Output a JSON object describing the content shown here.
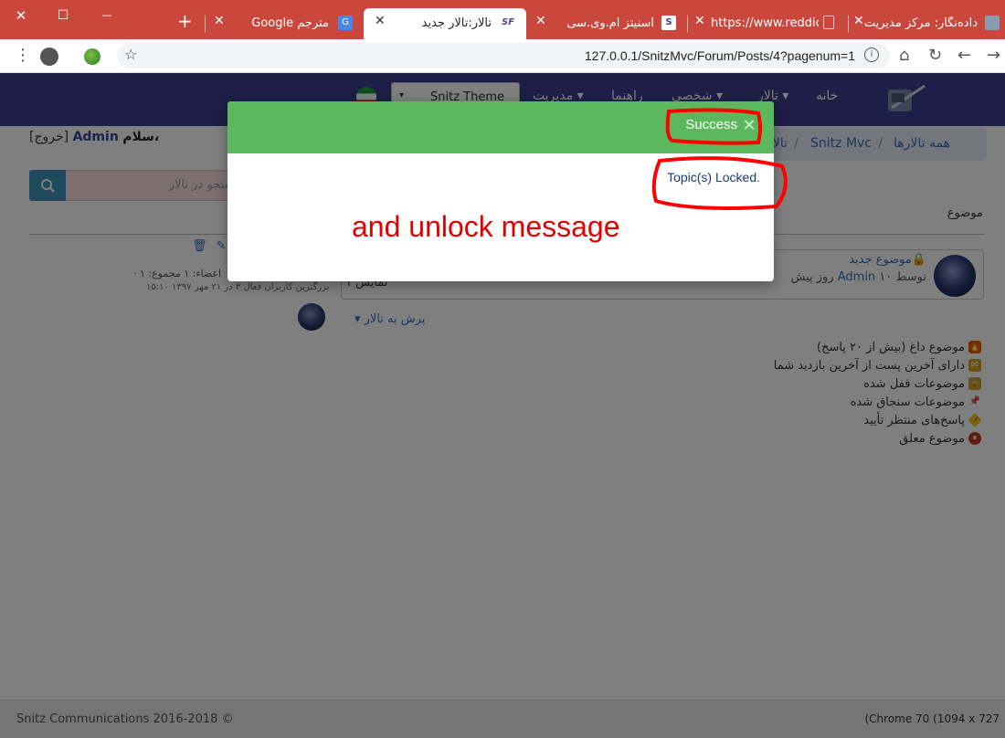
{
  "window": {
    "close_glyph": "✕",
    "maximize_glyph": "☐",
    "minimize_glyph": "—"
  },
  "tabs": [
    {
      "title": "داده‌نگار: مرکز مدیریت",
      "close": "✕",
      "favicon_color": "#8a9ab0"
    },
    {
      "title": "https://www.reddick.",
      "close": "✕",
      "favicon_color": "#ffffff"
    },
    {
      "title": "اسنیتز ام.وی.سی",
      "close": "✕",
      "favicon_color": "#3a3f8f",
      "favicon_text": "S"
    },
    {
      "title": "تالار:تالار جدید",
      "close": "✕",
      "favicon_color": "#ffffff",
      "favicon_text": "SF",
      "active": true
    },
    {
      "title": "مترجم Google",
      "close": "✕",
      "favicon_color": "#4a86e8",
      "favicon_text": "G"
    }
  ],
  "new_tab_glyph": "+",
  "address": {
    "url": "127.0.0.1/SnitzMvc/Forum/Posts/4?pagenum=1"
  },
  "nav": {
    "home": "خانه",
    "forums": "تالار ▾",
    "personal": "شخصی ▾",
    "help": "راهنما",
    "admin": "مدیریت ▾",
    "theme": "Snitz Theme",
    "theme_caret": "▾"
  },
  "greeting": {
    "hello": "سلام،",
    "user": "Admin",
    "logout": "[خروج]"
  },
  "breadcrumb": {
    "all_forums": "همه تالارها",
    "sep": "/",
    "snitz": "Snitz Mvc",
    "forum": "تالار"
  },
  "search": {
    "placeholder": "جستجو در تالار"
  },
  "topics_header": "موضوع",
  "topic": {
    "title": "موضوع جدید",
    "lock_glyph": "🔒",
    "by_label": "توسط",
    "author": "Admin",
    "age": "۱۰ روز پیش",
    "fragment": "۱ نمایش"
  },
  "stats": {
    "line1": "اعضاء: ۱ مجموع: ۱ ·",
    "line2": "بزرگترین کاربران فعال ۳ در ۲۱ مهر ۱۳۹۷ ۱۵:۱۰"
  },
  "jump_to": "پرش به تالار ▾",
  "legend": [
    {
      "label": "موضوع داغ (بیش از ۲۰ پاسخ)",
      "color": "#e65c00",
      "glyph": "🔥"
    },
    {
      "label": "دارای آخرین پست از آخرین بازدید شما",
      "color": "#d4a017",
      "glyph": "✉"
    },
    {
      "label": "موضوعات قفل شده",
      "color": "#c9a13b",
      "glyph": "🔒"
    },
    {
      "label": "موضوعات سنجاق شده",
      "color": "#c0392b",
      "glyph": "📌"
    },
    {
      "label": "پاسخ‌های منتظر تأیید",
      "color": "#f0c419",
      "glyph": "!"
    },
    {
      "label": "موضوع معلق",
      "color": "#c0392b",
      "glyph": "⏸"
    }
  ],
  "footer": {
    "copyright": "Snitz Communications 2016-2018 ©",
    "resolution": "(Chrome 70 (1094 x 727"
  },
  "modal": {
    "title": "Success",
    "close_glyph": "✕",
    "message": "Topic(s) Locked.",
    "header_color": "#5cb85c"
  },
  "annotation": {
    "text": "and unlock message",
    "color": "#e00000"
  }
}
